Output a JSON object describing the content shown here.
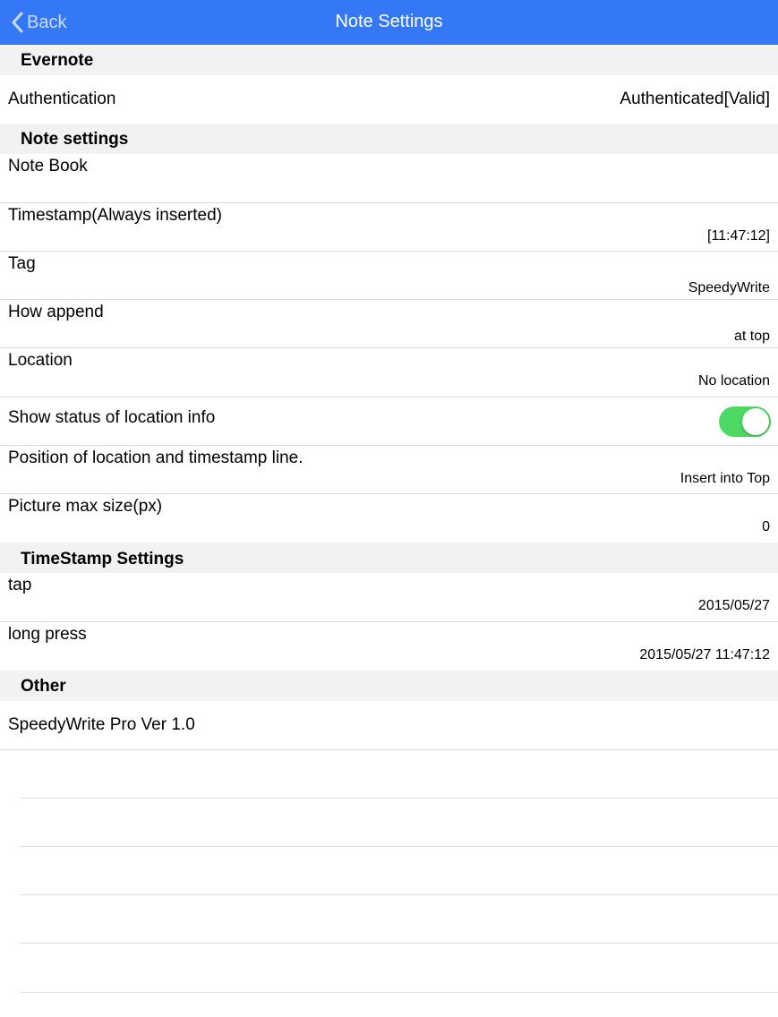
{
  "nav": {
    "back_label": "Back",
    "title": "Note Settings"
  },
  "sections": {
    "evernote": "Evernote",
    "note_settings": "Note settings",
    "timestamp_settings": "TimeStamp Settings",
    "other": "Other"
  },
  "rows": {
    "authentication": {
      "title": "Authentication",
      "value": "Authenticated[Valid]"
    },
    "note_book": {
      "title": "Note Book",
      "value": ""
    },
    "timestamp": {
      "title": "Timestamp(Always inserted)",
      "value": "[11:47:12]"
    },
    "tag": {
      "title": "Tag",
      "value": "SpeedyWrite"
    },
    "how_append": {
      "title": "How append",
      "value": "at top"
    },
    "location": {
      "title": "Location",
      "value": "No location"
    },
    "show_status": {
      "title": "Show status of location info",
      "toggle_on": true
    },
    "position": {
      "title": "Position of location and timestamp line.",
      "value": "Insert into Top"
    },
    "picture_max": {
      "title": "Picture max size(px)",
      "value": "0"
    },
    "tap": {
      "title": "tap",
      "value": "2015/05/27"
    },
    "long_press": {
      "title": "long press",
      "value": "2015/05/27 11:47:12"
    },
    "version": {
      "title": "SpeedyWrite Pro Ver 1.0"
    }
  },
  "colors": {
    "nav_bar": "#3478f6",
    "section_bg": "#f2f2f2",
    "toggle_on": "#4cd964"
  },
  "icons": {
    "back": "chevron-left-icon"
  }
}
